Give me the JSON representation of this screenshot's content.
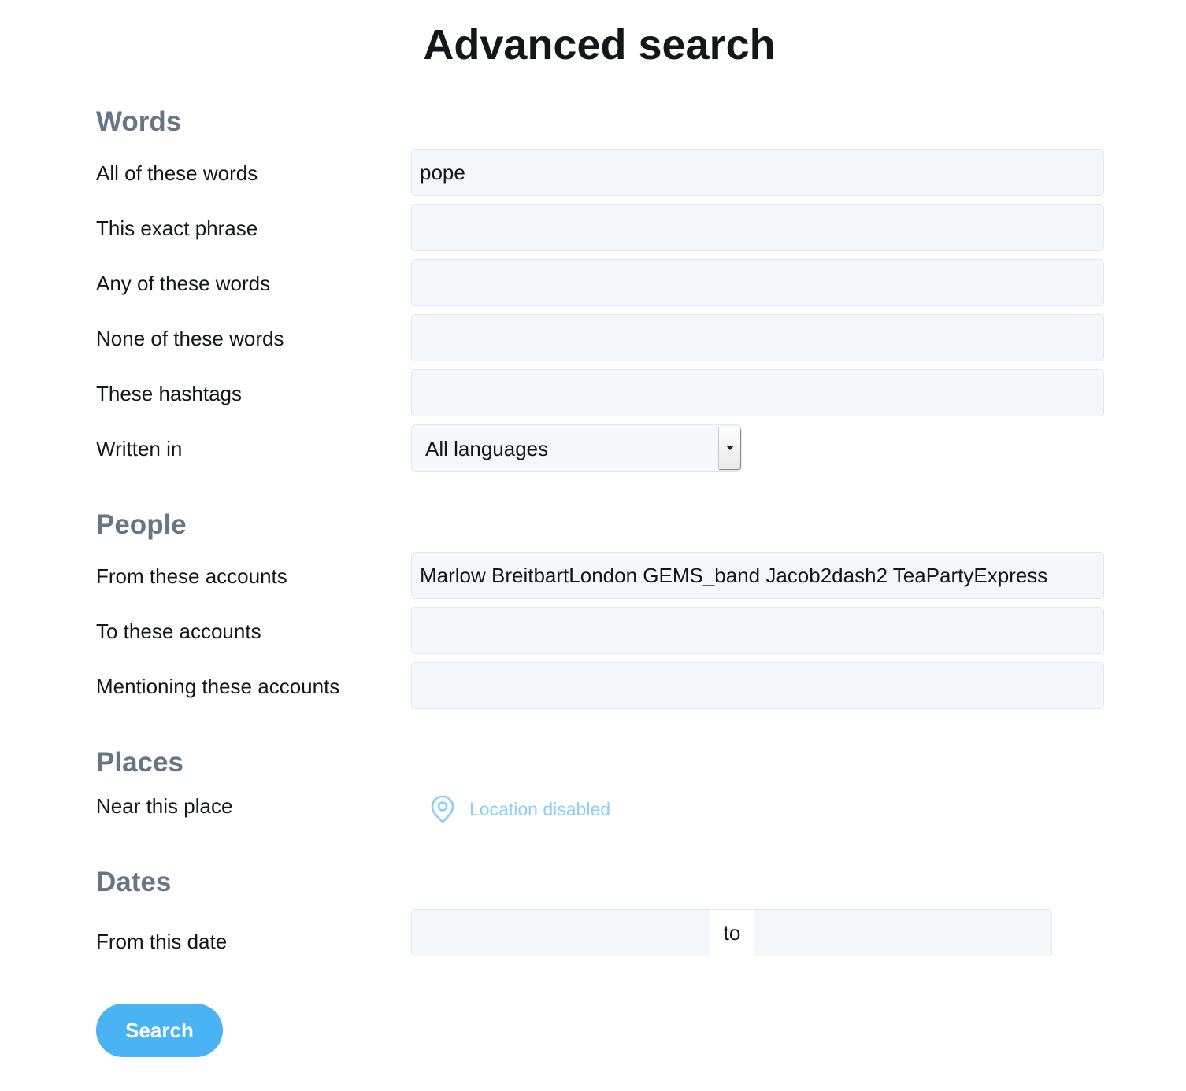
{
  "page": {
    "title": "Advanced search"
  },
  "words": {
    "heading": "Words",
    "all_words": {
      "label": "All of these words",
      "value": "pope"
    },
    "exact_phrase": {
      "label": "This exact phrase",
      "value": ""
    },
    "any_words": {
      "label": "Any of these words",
      "value": ""
    },
    "none_words": {
      "label": "None of these words",
      "value": ""
    },
    "hashtags": {
      "label": "These hashtags",
      "value": ""
    },
    "written_in": {
      "label": "Written in",
      "value": "All languages"
    }
  },
  "people": {
    "heading": "People",
    "from_accounts": {
      "label": "From these accounts",
      "value": "Marlow BreitbartLondon GEMS_band Jacob2dash2 TeaPartyExpress"
    },
    "to_accounts": {
      "label": "To these accounts",
      "value": ""
    },
    "mentioning_accounts": {
      "label": "Mentioning these accounts",
      "value": ""
    }
  },
  "places": {
    "heading": "Places",
    "near_place": {
      "label": "Near this place",
      "status": "Location disabled",
      "icon": "location-pin-icon"
    }
  },
  "dates": {
    "heading": "Dates",
    "from_date": {
      "label": "From this date",
      "from_value": "",
      "separator": "to",
      "to_value": ""
    }
  },
  "actions": {
    "search_label": "Search"
  },
  "colors": {
    "heading": "#657786",
    "input_bg": "#f5f8fa",
    "input_border": "#e1e8ed",
    "button_bg": "#4ab3f4",
    "location_text": "#8ecdf8"
  }
}
